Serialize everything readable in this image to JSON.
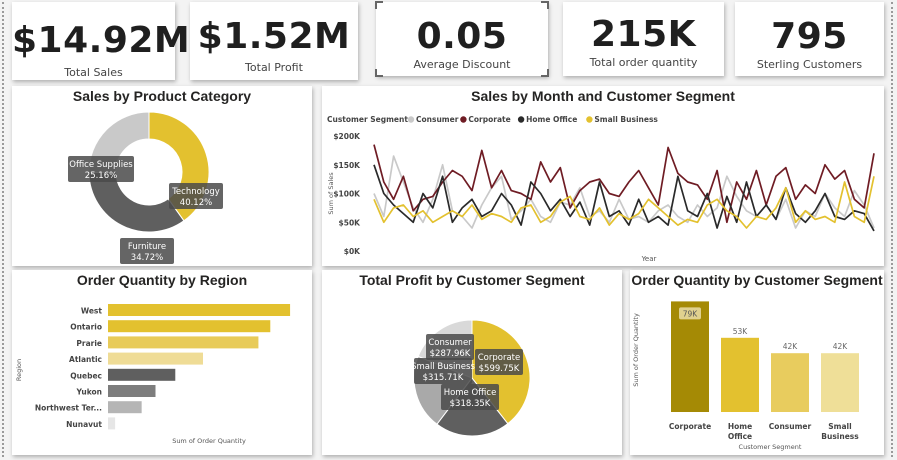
{
  "kpis": [
    {
      "value": "$14.92M",
      "label": "Total Sales"
    },
    {
      "value": "$1.52M",
      "label": "Total Profit"
    },
    {
      "value": "0.05",
      "label": "Average Discount"
    },
    {
      "value": "215K",
      "label": "Total order quantity"
    },
    {
      "value": "795",
      "label": "Sterling Customers"
    }
  ],
  "colors": {
    "technology": "#e3c12f",
    "furniture": "#5f5f5f",
    "office_supplies": "#c9c9c9",
    "consumer": "#c9c9c9",
    "corporate": "#6f1c24",
    "home_office": "#2a2a2a",
    "small_business": "#e3c12f"
  },
  "chart_data": [
    {
      "type": "pie",
      "title": "Sales by Product Category",
      "donut": true,
      "slices": [
        {
          "name": "Technology",
          "pct": 40.12,
          "label": "40.12%",
          "color": "#e3c12f"
        },
        {
          "name": "Furniture",
          "pct": 34.72,
          "label": "34.72%",
          "color": "#5f5f5f"
        },
        {
          "name": "Office Supplies",
          "pct": 25.16,
          "label": "25.16%",
          "color": "#c9c9c9"
        }
      ]
    },
    {
      "type": "line",
      "title": "Sales by Month and Customer Segment",
      "legend_title": "Customer Segment:",
      "legend_position": "top-left",
      "xlabel": "Year",
      "ylabel": "Sum of Sales",
      "ylim": [
        0,
        200000
      ],
      "yticks": [
        "$0K",
        "$50K",
        "$100K",
        "$150K",
        "$200K"
      ],
      "series": [
        {
          "name": "Consumer",
          "color": "#c9c9c9",
          "values": [
            100000,
            60000,
            165000,
            120000,
            75000,
            50000,
            90000,
            150000,
            70000,
            60000,
            40000,
            80000,
            110000,
            130000,
            55000,
            70000,
            90000,
            60000,
            50000,
            85000,
            80000,
            110000,
            60000,
            70000,
            50000,
            90000,
            55000,
            60000,
            50000,
            70000,
            80000,
            60000,
            50000,
            80000,
            60000,
            75000,
            130000,
            95000,
            70000,
            60000,
            80000,
            55000,
            90000,
            40000,
            70000,
            60000,
            100000,
            75000,
            60000,
            105000,
            80000,
            40000
          ]
        },
        {
          "name": "Corporate",
          "color": "#6f1c24",
          "values": [
            185000,
            120000,
            90000,
            130000,
            70000,
            90000,
            95000,
            120000,
            140000,
            130000,
            105000,
            175000,
            110000,
            140000,
            105000,
            100000,
            90000,
            155000,
            120000,
            145000,
            75000,
            105000,
            120000,
            125000,
            100000,
            95000,
            120000,
            140000,
            110000,
            80000,
            180000,
            135000,
            120000,
            115000,
            90000,
            140000,
            50000,
            120000,
            90000,
            140000,
            80000,
            130000,
            145000,
            90000,
            115000,
            100000,
            150000,
            125000,
            140000,
            90000,
            75000,
            170000
          ]
        },
        {
          "name": "Home Office",
          "color": "#2a2a2a",
          "values": [
            150000,
            100000,
            80000,
            65000,
            50000,
            100000,
            75000,
            130000,
            50000,
            75000,
            90000,
            60000,
            70000,
            100000,
            80000,
            45000,
            120000,
            100000,
            70000,
            90000,
            60000,
            85000,
            45000,
            120000,
            60000,
            70000,
            45000,
            90000,
            50000,
            60000,
            45000,
            130000,
            70000,
            60000,
            100000,
            40000,
            95000,
            50000,
            120000,
            60000,
            80000,
            55000,
            110000,
            65000,
            50000,
            70000,
            100000,
            60000,
            55000,
            70000,
            65000,
            35000
          ]
        },
        {
          "name": "Small Business",
          "color": "#e3c12f",
          "values": [
            90000,
            50000,
            75000,
            80000,
            60000,
            70000,
            50000,
            60000,
            70000,
            60000,
            80000,
            55000,
            65000,
            60000,
            50000,
            75000,
            80000,
            50000,
            60000,
            85000,
            95000,
            60000,
            55000,
            75000,
            45000,
            65000,
            55000,
            65000,
            90000,
            75000,
            60000,
            45000,
            55000,
            50000,
            80000,
            90000,
            70000,
            60000,
            40000,
            60000,
            55000,
            75000,
            110000,
            50000,
            70000,
            55000,
            60000,
            50000,
            120000,
            60000,
            50000,
            130000
          ]
        }
      ]
    },
    {
      "type": "bar",
      "orientation": "horizontal",
      "title": "Order Quantity by Region",
      "xlabel": "Sum of Order Quantity",
      "ylabel": "Region",
      "categories": [
        "West",
        "Ontario",
        "Prarie",
        "Atlantic",
        "Quebec",
        "Yukon",
        "Northwest Ter...",
        "Nunavut"
      ],
      "values": [
        46000,
        41000,
        38000,
        24000,
        17000,
        12000,
        8500,
        1800
      ],
      "colors": [
        "#e3c12f",
        "#e3c12f",
        "#e8cb59",
        "#efdc96",
        "#5f5f5f",
        "#7d7d7d",
        "#b5b5b5",
        "#e6e6e6"
      ]
    },
    {
      "type": "pie",
      "title": "Total Profit by Customer Segment",
      "slices": [
        {
          "name": "Corporate",
          "value": 599750,
          "label": "$599.75K",
          "color": "#e3c12f"
        },
        {
          "name": "Home Office",
          "value": 318350,
          "label": "$318.35K",
          "color": "#5f5f5f"
        },
        {
          "name": "Small Business",
          "value": 315710,
          "label": "$315.71K",
          "color": "#a9a9a9"
        },
        {
          "name": "Consumer",
          "value": 287960,
          "label": "$287.96K",
          "color": "#d9d9d9"
        }
      ]
    },
    {
      "type": "bar",
      "title": "Order Quantity by Customer Segment",
      "xlabel": "Customer Segment",
      "ylabel": "Sum of Order Quantity",
      "ylim": [
        0,
        80000
      ],
      "categories": [
        "Corporate",
        "Home Office",
        "Consumer",
        "Small Business"
      ],
      "category_lines": [
        [
          "Corporate"
        ],
        [
          "Home",
          "Office"
        ],
        [
          "Consumer"
        ],
        [
          "Small",
          "Business"
        ]
      ],
      "values": [
        79000,
        53000,
        42000,
        42000
      ],
      "data_labels": [
        "79K",
        "53K",
        "42K",
        "42K"
      ],
      "colors": [
        "#a58a05",
        "#e3c12f",
        "#e8cc5e",
        "#efdf98"
      ]
    }
  ]
}
